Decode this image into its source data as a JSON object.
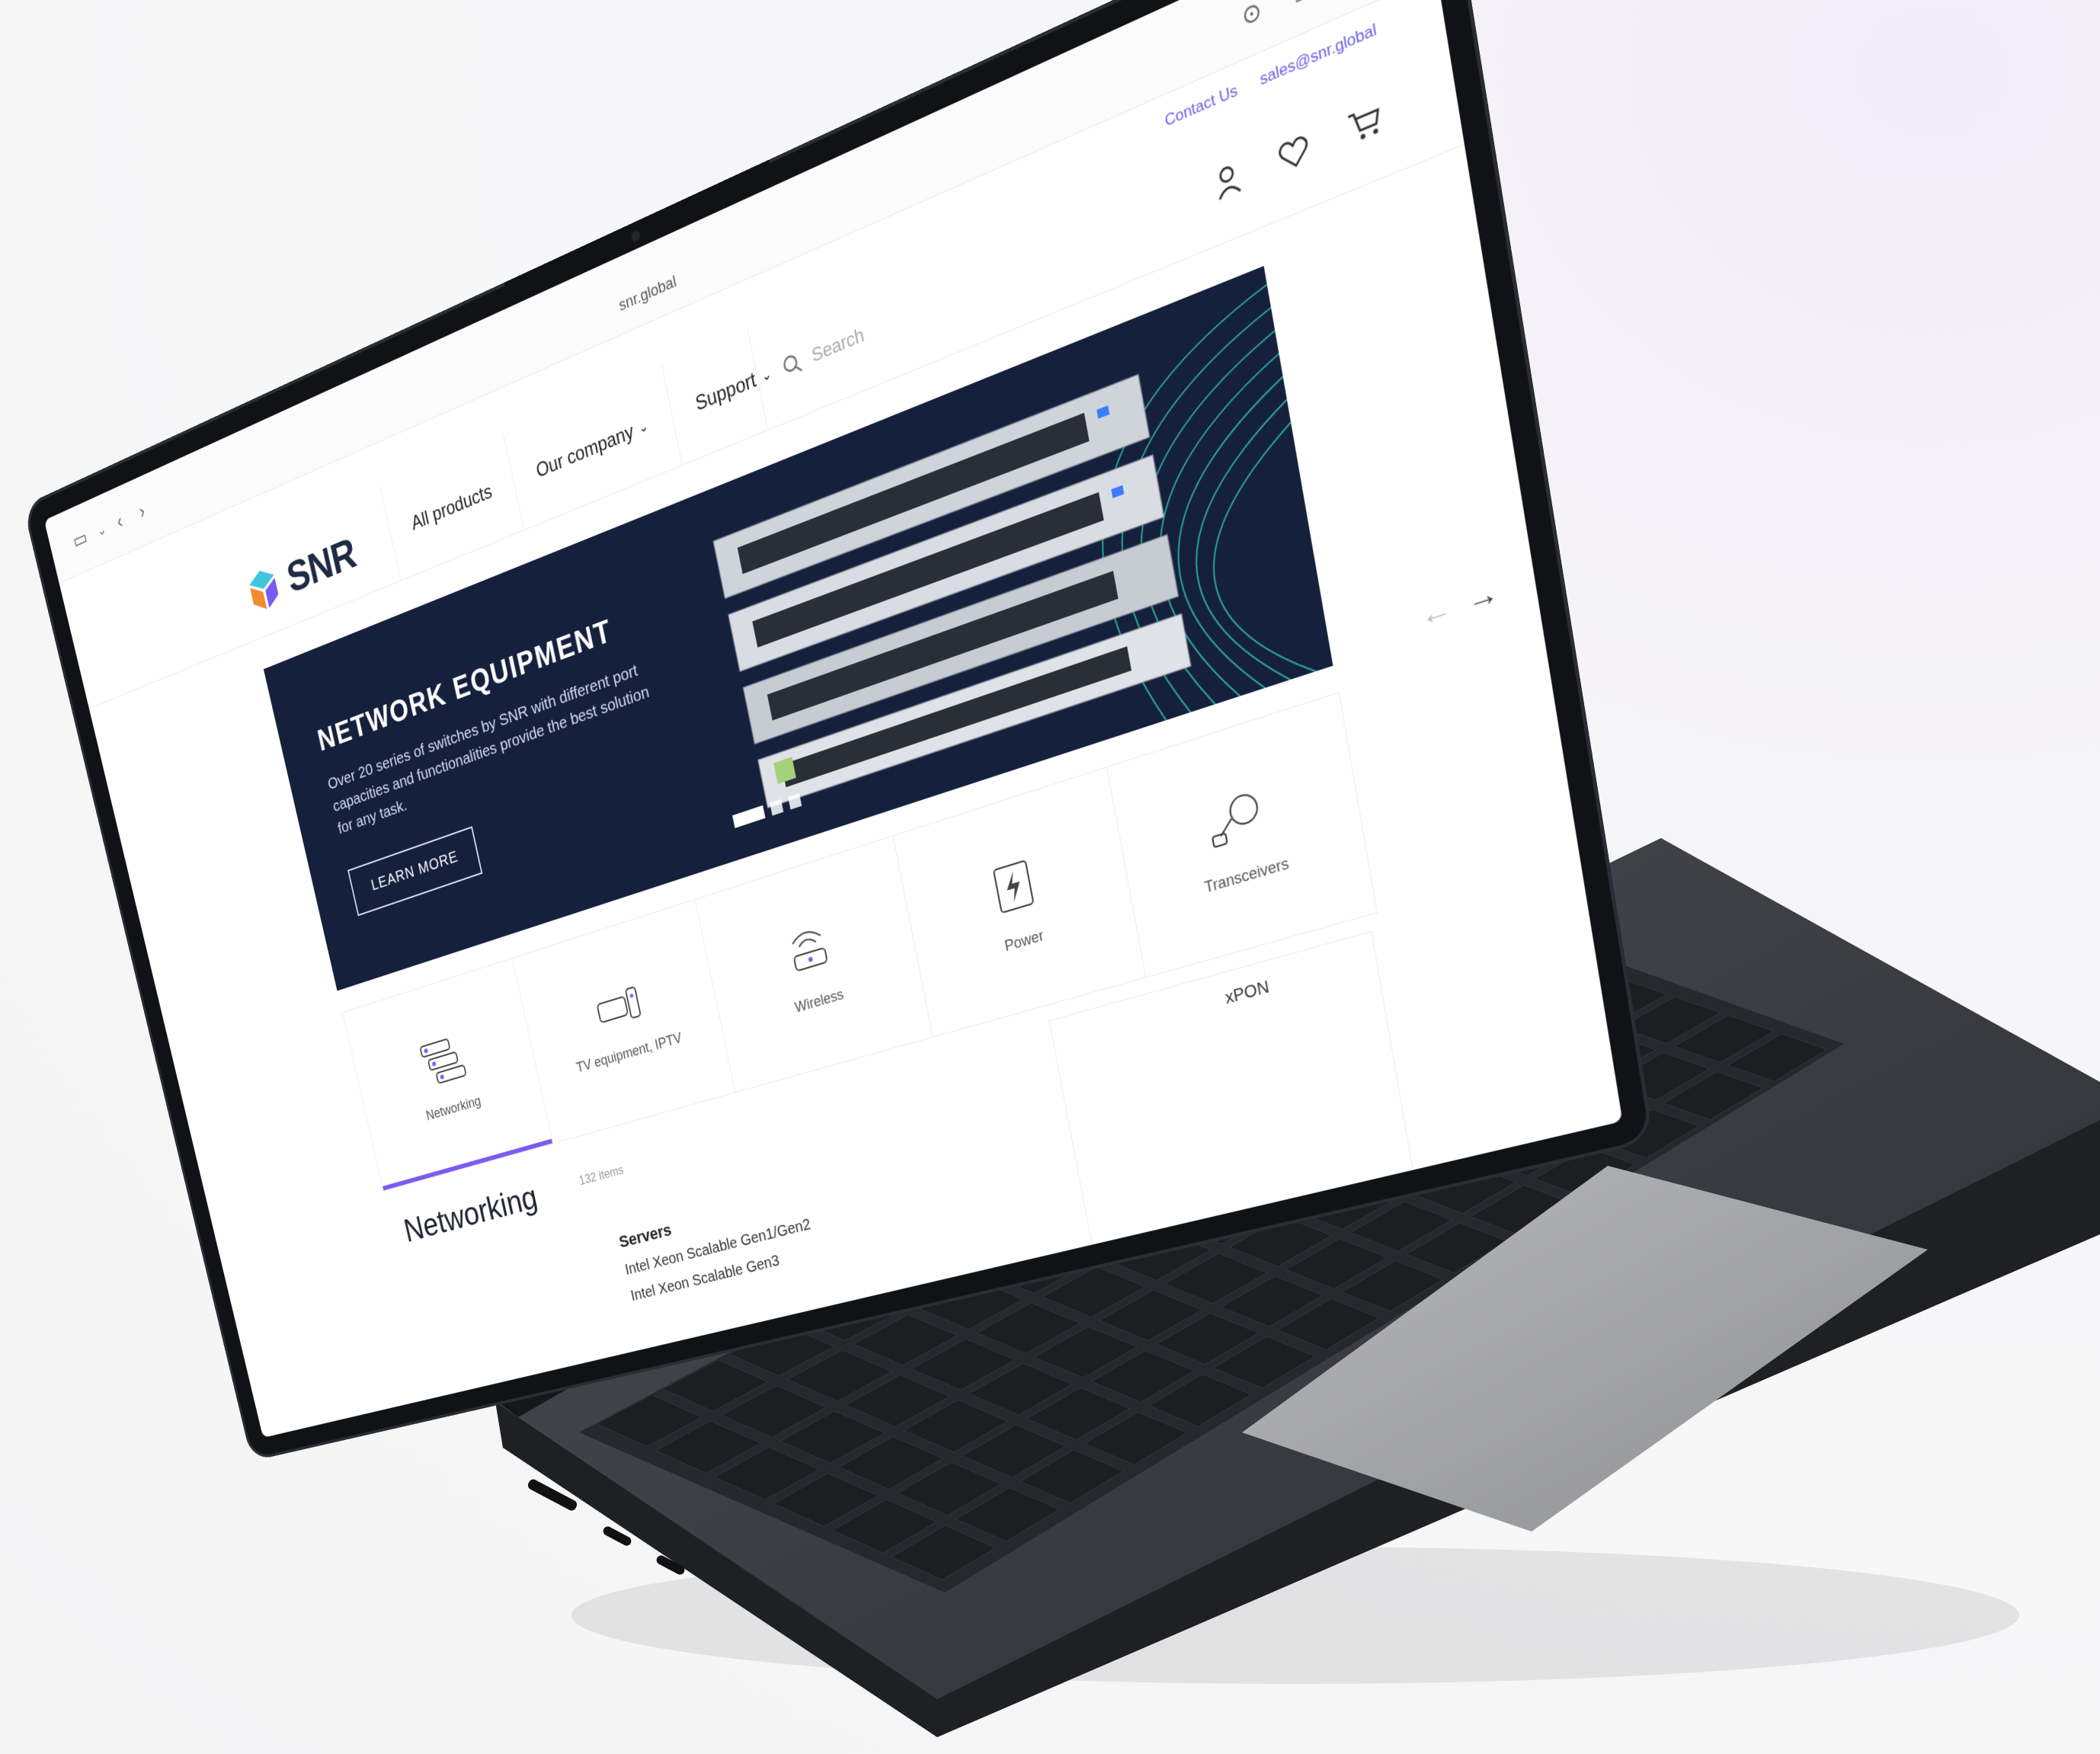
{
  "browser": {
    "url": "snr.global",
    "back_icon": "chevron-left-icon",
    "forward_icon": "chevron-right-icon",
    "sidebar_icon": "sidebar-icon"
  },
  "topbar": {
    "contact_label": "Contact Us",
    "email": "sales@snr.global"
  },
  "header": {
    "logo_text": "SNR",
    "nav": [
      {
        "label": "All products"
      },
      {
        "label": "Our company"
      },
      {
        "label": "Support"
      }
    ],
    "search_placeholder": "Search"
  },
  "hero": {
    "title": "NETWORK EQUIPMENT",
    "text": "Over 20 series of switches by SNR with different port capacities and functionalities provide the best solution for any task.",
    "button_label": "LEARN MORE",
    "slide_count": 3,
    "active_slide": 1
  },
  "categories": [
    {
      "label": "Networking",
      "icon": "network-switch-icon",
      "active": true
    },
    {
      "label": "TV equipment, IPTV",
      "icon": "tv-box-icon",
      "active": false
    },
    {
      "label": "Wireless",
      "icon": "wifi-router-icon",
      "active": false
    },
    {
      "label": "Power",
      "icon": "power-icon",
      "active": false
    },
    {
      "label": "Transceivers",
      "icon": "transceiver-icon",
      "active": false
    }
  ],
  "section": {
    "title": "Networking",
    "count": "132 items",
    "subsection_title": "Servers",
    "items": [
      "Intel Xeon Scalable Gen1/Gen2",
      "Intel Xeon Scalable Gen3"
    ],
    "side_label": "xPON"
  },
  "colors": {
    "accent": "#7b5cf0",
    "hero_bg": "#15203d",
    "laptop": "#3a3d43",
    "keys": "#1c1e22"
  }
}
